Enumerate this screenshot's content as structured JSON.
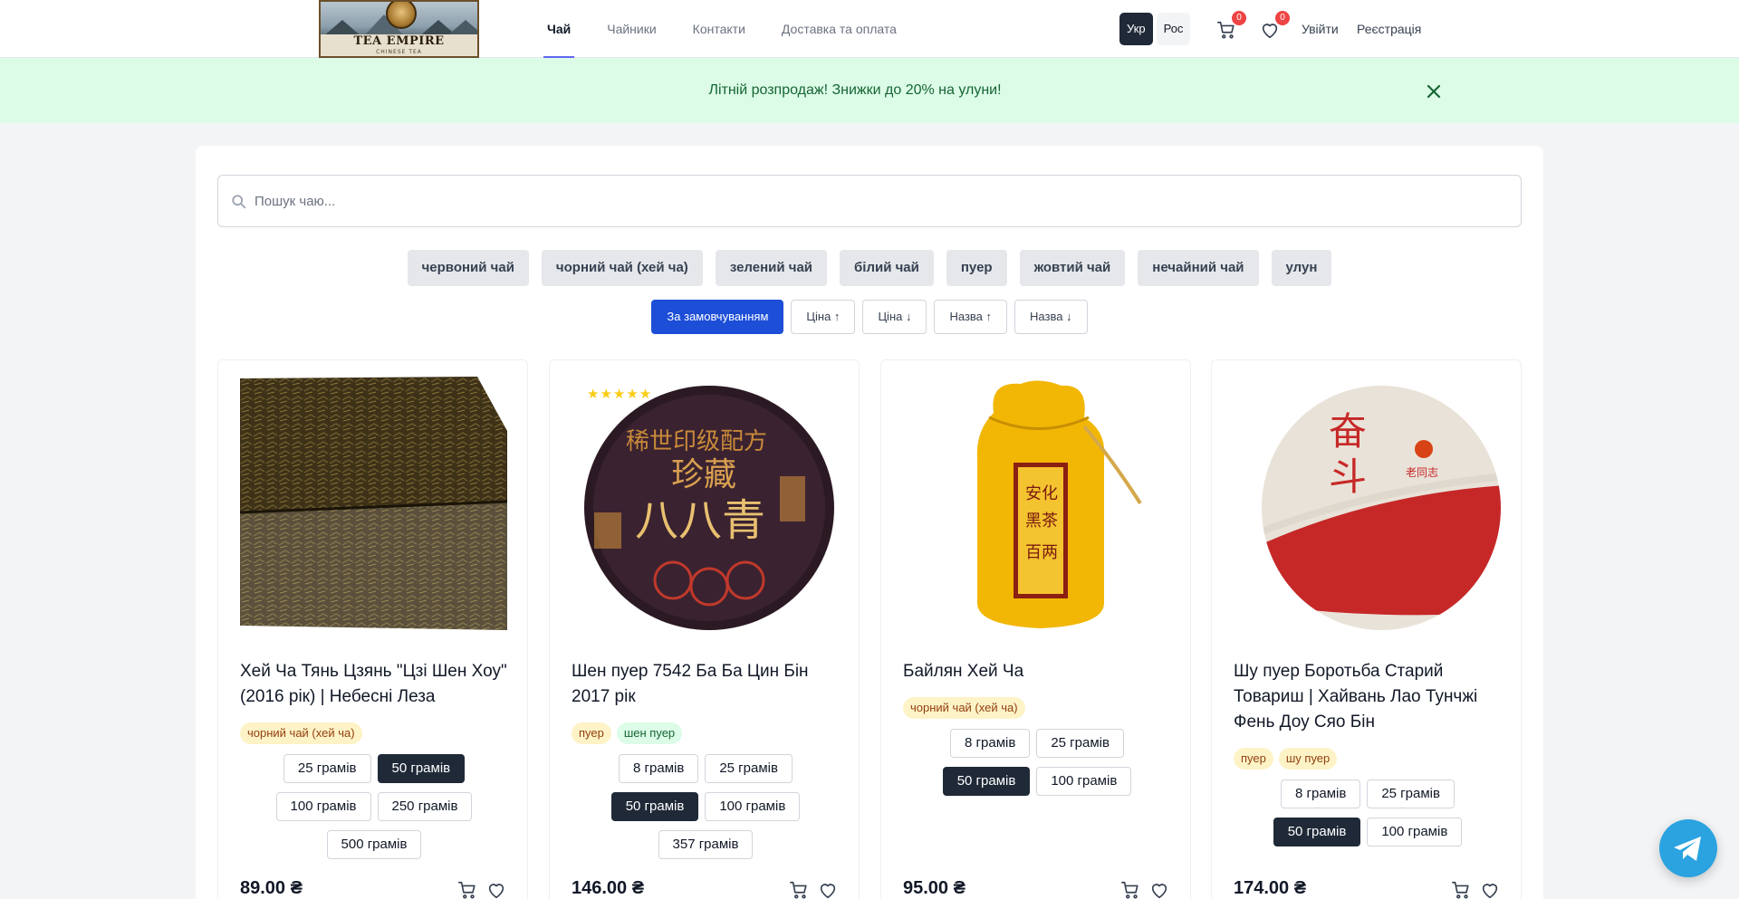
{
  "header": {
    "logo_text": "TEA EMPIRE",
    "logo_sub": "CHINESE TEA",
    "nav": [
      "Чай",
      "Чайники",
      "Контакти",
      "Доставка та оплата"
    ],
    "lang": [
      "Укр",
      "Рос"
    ],
    "cart_count": "0",
    "wishlist_count": "0",
    "login": "Увійти",
    "register": "Реєстрація"
  },
  "promo": {
    "text": "Літній розпродаж! Знижки до 20% на улуни!"
  },
  "search": {
    "placeholder": "Пошук чаю..."
  },
  "categories": [
    "червоний чай",
    "чорний чай (хей ча)",
    "зелений чай",
    "білий чай",
    "пуер",
    "жовтий чай",
    "нечайний чай",
    "улун"
  ],
  "sorts": [
    "За замовчуванням",
    "Ціна ↑",
    "Ціна ↓",
    "Назва ↑",
    "Назва ↓"
  ],
  "products": [
    {
      "title": "Хей Ча Тянь Цзянь \"Цзі Шен Хоу\" (2016 рік) | Небесні Леза",
      "tags": [
        "чорний чай (хей ча)"
      ],
      "weights": [
        "25 грамів",
        "50 грамів",
        "100 грамів",
        "250 грамів",
        "500 грамів"
      ],
      "selected_weight": "50 грамів",
      "price": "89.00 ₴"
    },
    {
      "title": "Шен пуер 7542 Ба Ба Цин Бін 2017 рік",
      "stars": "★★★★★",
      "tags": [
        "пуер",
        "шен пуер"
      ],
      "weights": [
        "8 грамів",
        "25 грамів",
        "50 грамів",
        "100 грамів",
        "357 грамів"
      ],
      "selected_weight": "50 грамів",
      "price": "146.00 ₴"
    },
    {
      "title": "Байлян Хей Ча",
      "tags": [
        "чорний чай (хей ча)"
      ],
      "weights": [
        "8 грамів",
        "25 грамів",
        "50 грамів",
        "100 грамів"
      ],
      "selected_weight": "50 грамів",
      "price": "95.00 ₴"
    },
    {
      "title": "Шу пуер Боротьба Старий Товариш | Хайвань Лао Тунчжі Фень Доу Сяо Бін",
      "tags": [
        "пуер",
        "шу пуер"
      ],
      "weights": [
        "8 грамів",
        "25 грамів",
        "50 грамів",
        "100 грамів"
      ],
      "selected_weight": "50 грамів",
      "price": "174.00 ₴"
    }
  ]
}
